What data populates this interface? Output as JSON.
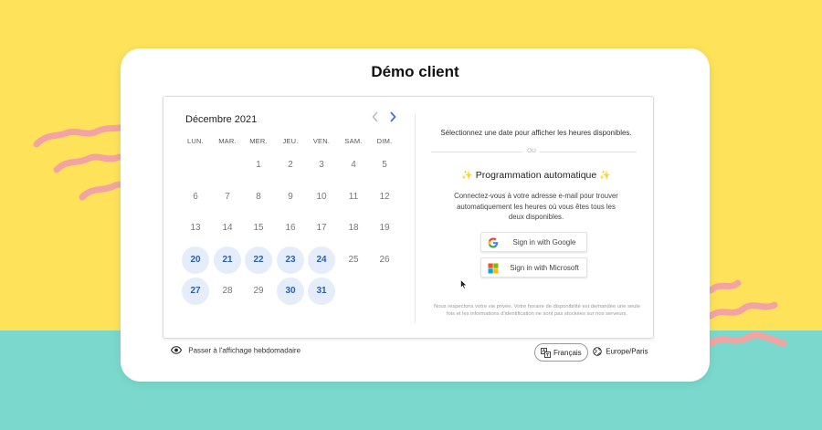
{
  "card": {
    "title": "Démo client"
  },
  "calendar": {
    "month_label": "Décembre 2021",
    "prev_icon": "chevron-left-icon",
    "next_icon": "chevron-right-icon",
    "weekdays": [
      "LUN.",
      "MAR.",
      "MER.",
      "JEU.",
      "VEN.",
      "SAM.",
      "DIM."
    ],
    "weeks": [
      [
        null,
        null,
        {
          "d": "1",
          "a": false
        },
        {
          "d": "2",
          "a": false
        },
        {
          "d": "3",
          "a": false
        },
        {
          "d": "4",
          "a": false
        },
        {
          "d": "5",
          "a": false
        }
      ],
      [
        {
          "d": "6",
          "a": false
        },
        {
          "d": "7",
          "a": false
        },
        {
          "d": "8",
          "a": false
        },
        {
          "d": "9",
          "a": false
        },
        {
          "d": "10",
          "a": false
        },
        {
          "d": "11",
          "a": false
        },
        {
          "d": "12",
          "a": false
        }
      ],
      [
        {
          "d": "13",
          "a": false
        },
        {
          "d": "14",
          "a": false
        },
        {
          "d": "15",
          "a": false
        },
        {
          "d": "16",
          "a": false
        },
        {
          "d": "17",
          "a": false
        },
        {
          "d": "18",
          "a": false
        },
        {
          "d": "19",
          "a": false
        }
      ],
      [
        {
          "d": "20",
          "a": true
        },
        {
          "d": "21",
          "a": true
        },
        {
          "d": "22",
          "a": true
        },
        {
          "d": "23",
          "a": true
        },
        {
          "d": "24",
          "a": true
        },
        {
          "d": "25",
          "a": false
        },
        {
          "d": "26",
          "a": false
        }
      ],
      [
        {
          "d": "27",
          "a": true
        },
        {
          "d": "28",
          "a": false
        },
        {
          "d": "29",
          "a": false
        },
        {
          "d": "30",
          "a": true
        },
        {
          "d": "31",
          "a": true
        },
        null,
        null
      ]
    ]
  },
  "right": {
    "select_message": "Sélectionnez une date pour afficher les heures disponibles.",
    "or_label": "OU",
    "auto_title": "Programmation automatique",
    "sparkle": "✨",
    "auto_description": "Connectez-vous à votre adresse e-mail pour trouver automatiquement les heures où vous êtes tous les deux disponibles.",
    "google_button": "Sign in with Google",
    "microsoft_button": "Sign in with Microsoft",
    "privacy": "Nous respectons votre vie privée. Votre horaire de disponibilité est demandée une seule fois et les informations d'identification ne sont pas stockées sur nos serveurs."
  },
  "footer": {
    "weekly_view": "Passer à l'affichage hebdomadaire",
    "language": "Français",
    "timezone": "Europe/Paris"
  },
  "colors": {
    "background_top": "#fde25a",
    "background_bottom": "#7ad9cc",
    "squiggle": "#f4a3a3",
    "available_day_bg": "#e4edf9",
    "available_day_text": "#2f5fb0",
    "accent": "#3a6fd8"
  }
}
